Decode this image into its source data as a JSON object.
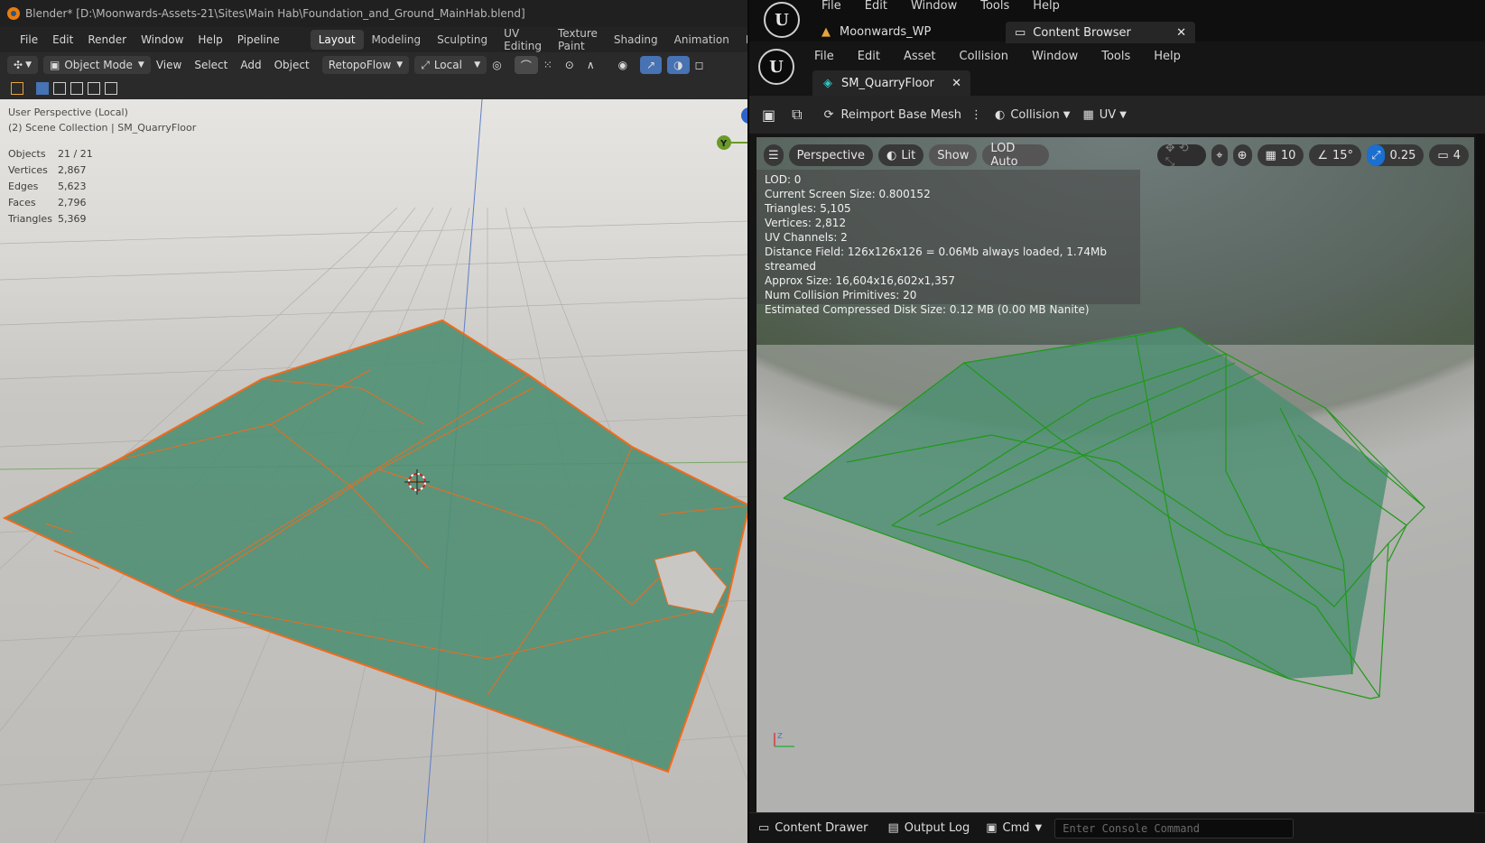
{
  "blender": {
    "title": "Blender* [D:\\Moonwards-Assets-21\\Sites\\Main Hab\\Foundation_and_Ground_MainHab.blend]",
    "menu": [
      "File",
      "Edit",
      "Render",
      "Window",
      "Help",
      "Pipeline"
    ],
    "workspaces": [
      "Layout",
      "Modeling",
      "Sculpting",
      "UV Editing",
      "Texture Paint",
      "Shading",
      "Animation",
      "Rendering"
    ],
    "active_workspace": "Layout",
    "header": {
      "mode": "Object Mode",
      "menus": [
        "View",
        "Select",
        "Add",
        "Object"
      ],
      "addon": "RetopoFlow",
      "orientation": "Local"
    },
    "viewport": {
      "perspective": "User Perspective (Local)",
      "collection": "(2) Scene Collection | SM_QuarryFloor",
      "gizmo_axis": "Y",
      "stats": [
        {
          "label": "Objects",
          "value": "21 / 21"
        },
        {
          "label": "Vertices",
          "value": "2,867"
        },
        {
          "label": "Edges",
          "value": "5,623"
        },
        {
          "label": "Faces",
          "value": "2,796"
        },
        {
          "label": "Triangles",
          "value": "5,369"
        }
      ]
    }
  },
  "unreal": {
    "menu_top": [
      "File",
      "Edit",
      "Window",
      "Tools",
      "Help"
    ],
    "project_tab": "Moonwards_WP",
    "content_browser_tab": "Content Browser",
    "menu_editor": [
      "File",
      "Edit",
      "Asset",
      "Collision",
      "Window",
      "Tools",
      "Help"
    ],
    "asset_tab": "SM_QuarryFloor",
    "toolbar": {
      "reimport": "Reimport Base Mesh",
      "collision": "Collision",
      "uv": "UV"
    },
    "viewport_tools": {
      "perspective": "Perspective",
      "lit": "Lit",
      "show": "Show",
      "lod": "LOD Auto",
      "grid_snap": "10",
      "angle_snap": "15°",
      "scale_snap": "0.25",
      "camera_speed": "4"
    },
    "info": [
      "LOD:  0",
      "Current Screen Size:  0.800152",
      "Triangles:  5,105",
      "Vertices:  2,812",
      "UV Channels:  2",
      "Distance Field:  126x126x126 = 0.06Mb always loaded, 1.74Mb streamed",
      "Approx Size: 16,604x16,602x1,357",
      "Num Collision Primitives:  20",
      "Estimated Compressed Disk Size: 0.12 MB (0.00 MB Nanite)"
    ],
    "bottom": {
      "content_drawer": "Content Drawer",
      "output_log": "Output Log",
      "cmd": "Cmd",
      "console_placeholder": "Enter Console Command"
    }
  },
  "colors": {
    "mesh_fill": "#4f8f73",
    "blender_edge": "#f26a1b",
    "unreal_wire": "#1e9a16"
  }
}
